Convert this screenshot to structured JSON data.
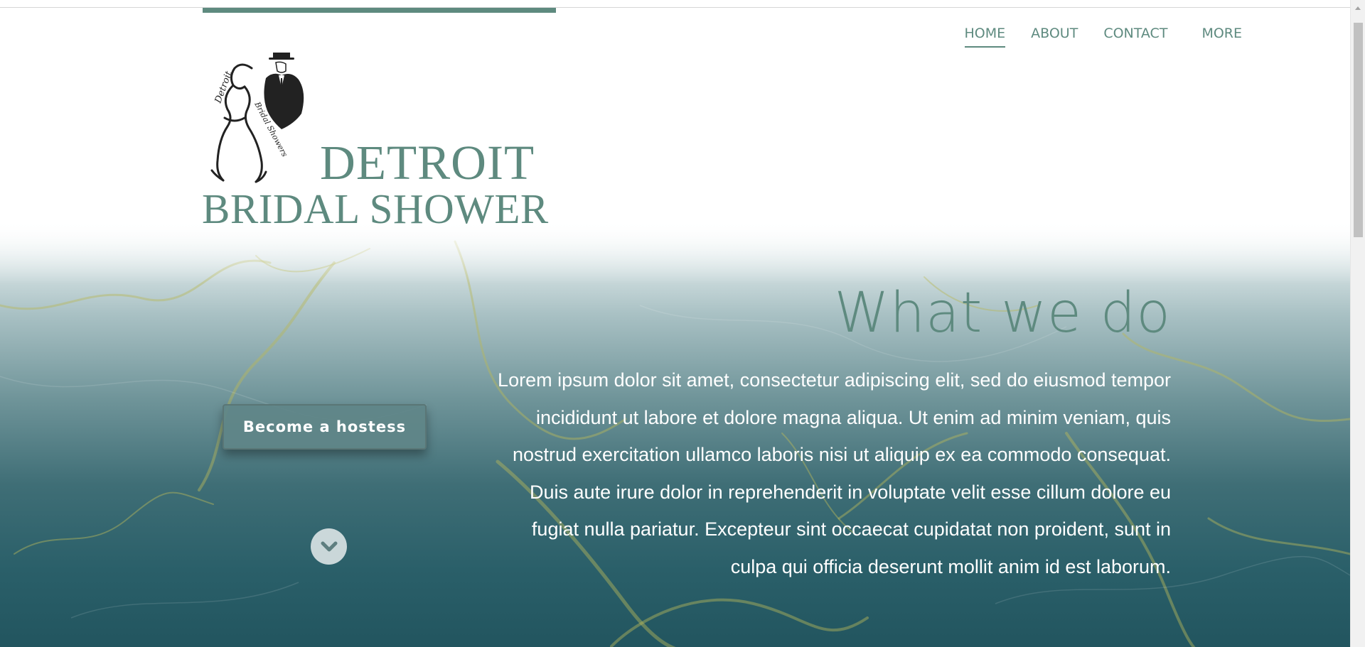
{
  "logo": {
    "line1": "DETROIT",
    "line2": "BRIDAL SHOWER",
    "script_text_1": "Detroit",
    "script_text_2": "Bridal Showers"
  },
  "nav": {
    "items": [
      {
        "label": "HOME",
        "active": true
      },
      {
        "label": "ABOUT",
        "active": false
      },
      {
        "label": "CONTACT",
        "active": false
      },
      {
        "label": "MORE",
        "active": false
      }
    ]
  },
  "hero": {
    "title": "What we do",
    "body": "Lorem ipsum dolor sit amet, consectetur adipiscing elit, sed do eiusmod tempor incididunt ut labore et dolore magna aliqua. Ut enim ad minim veniam, quis nostrud exercitation ullamco laboris nisi ut aliquip ex ea commodo consequat. Duis aute irure dolor in reprehenderit in voluptate velit esse cillum dolore eu fugiat nulla pariatur. Excepteur sint occaecat cupidatat non proident, sunt in culpa qui officia deserunt mollit anim id est laborum.",
    "cta_label": "Become a hostess",
    "scroll_icon": "chevron-down-icon"
  },
  "colors": {
    "accent": "#5e8a7f",
    "text_light": "#ffffff",
    "hero_dark": "#22555f"
  }
}
